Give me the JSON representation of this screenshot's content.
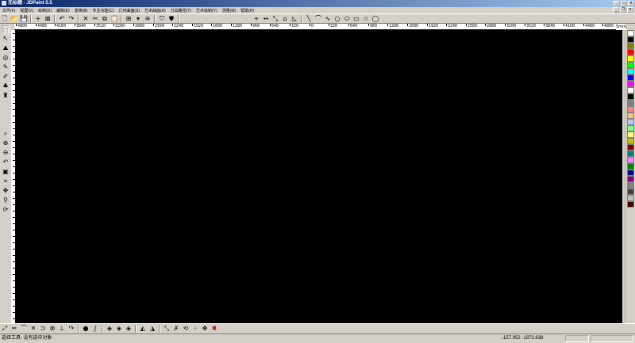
{
  "window": {
    "title": "无标题 - JDPaint 5.5"
  },
  "menu": [
    "文件(F)",
    "视图(V)",
    "绘制(D)",
    "编辑(E)",
    "变换(B)",
    "专业功能(C)",
    "几何曲面(S)",
    "艺术曲面(A)",
    "刀具路径(T)",
    "艺术绘制(Y)",
    "测量(M)",
    "帮助(H)"
  ],
  "toolbar_icons": [
    "new-icon",
    "open-icon",
    "save-icon",
    "sep",
    "snap-icon",
    "select-window-icon",
    "sep",
    "undo-icon",
    "redo-icon",
    "sep",
    "delete-icon",
    "cut-icon",
    "copy-icon",
    "paste-icon",
    "sep",
    "grid-icon",
    "dropdown-icon",
    "layer-icon",
    "sep",
    "shield-icon",
    "shield-dark-icon",
    "sep",
    "point-icon",
    "dimension-icon",
    "node-edit-icon",
    "polyline-icon",
    "rect-tool-icon",
    "sep",
    "line-icon",
    "arc-icon",
    "spline-icon",
    "circle-icon",
    "ellipse-icon",
    "rectangle-icon",
    "star-icon",
    "polygon-icon"
  ],
  "ruler": {
    "labels": [
      "4800",
      "4480",
      "4160",
      "3840",
      "3520",
      "3200",
      "2880",
      "2560",
      "2240",
      "1920",
      "1600",
      "1280",
      "960",
      "640",
      "320",
      "0",
      "320",
      "640",
      "960",
      "1280",
      "1600",
      "1920",
      "2240",
      "2560",
      "2880",
      "3200",
      "3520",
      "3840",
      "4160",
      "4480",
      "4800"
    ],
    "unit": "5mm"
  },
  "palette": [
    "#ffffff",
    "#000000",
    "#808000",
    "#ff0000",
    "#ffff00",
    "#00ff00",
    "#00ffff",
    "#0000ff",
    "#ff00ff",
    "#ffffff",
    "#000000",
    "#808080",
    "#ff8080",
    "#ffc080",
    "#c0c0ff",
    "#80ff80",
    "#ffff80",
    "#c0c000",
    "#800000",
    "#008080",
    "#ff80ff",
    "#008000",
    "#000080",
    "#800080",
    "#808080",
    "#404040",
    "#c0c0c0",
    "#400000"
  ],
  "status": {
    "message": "选择工具: 没有选中对象",
    "coords": "-157.952 -1873.638"
  }
}
